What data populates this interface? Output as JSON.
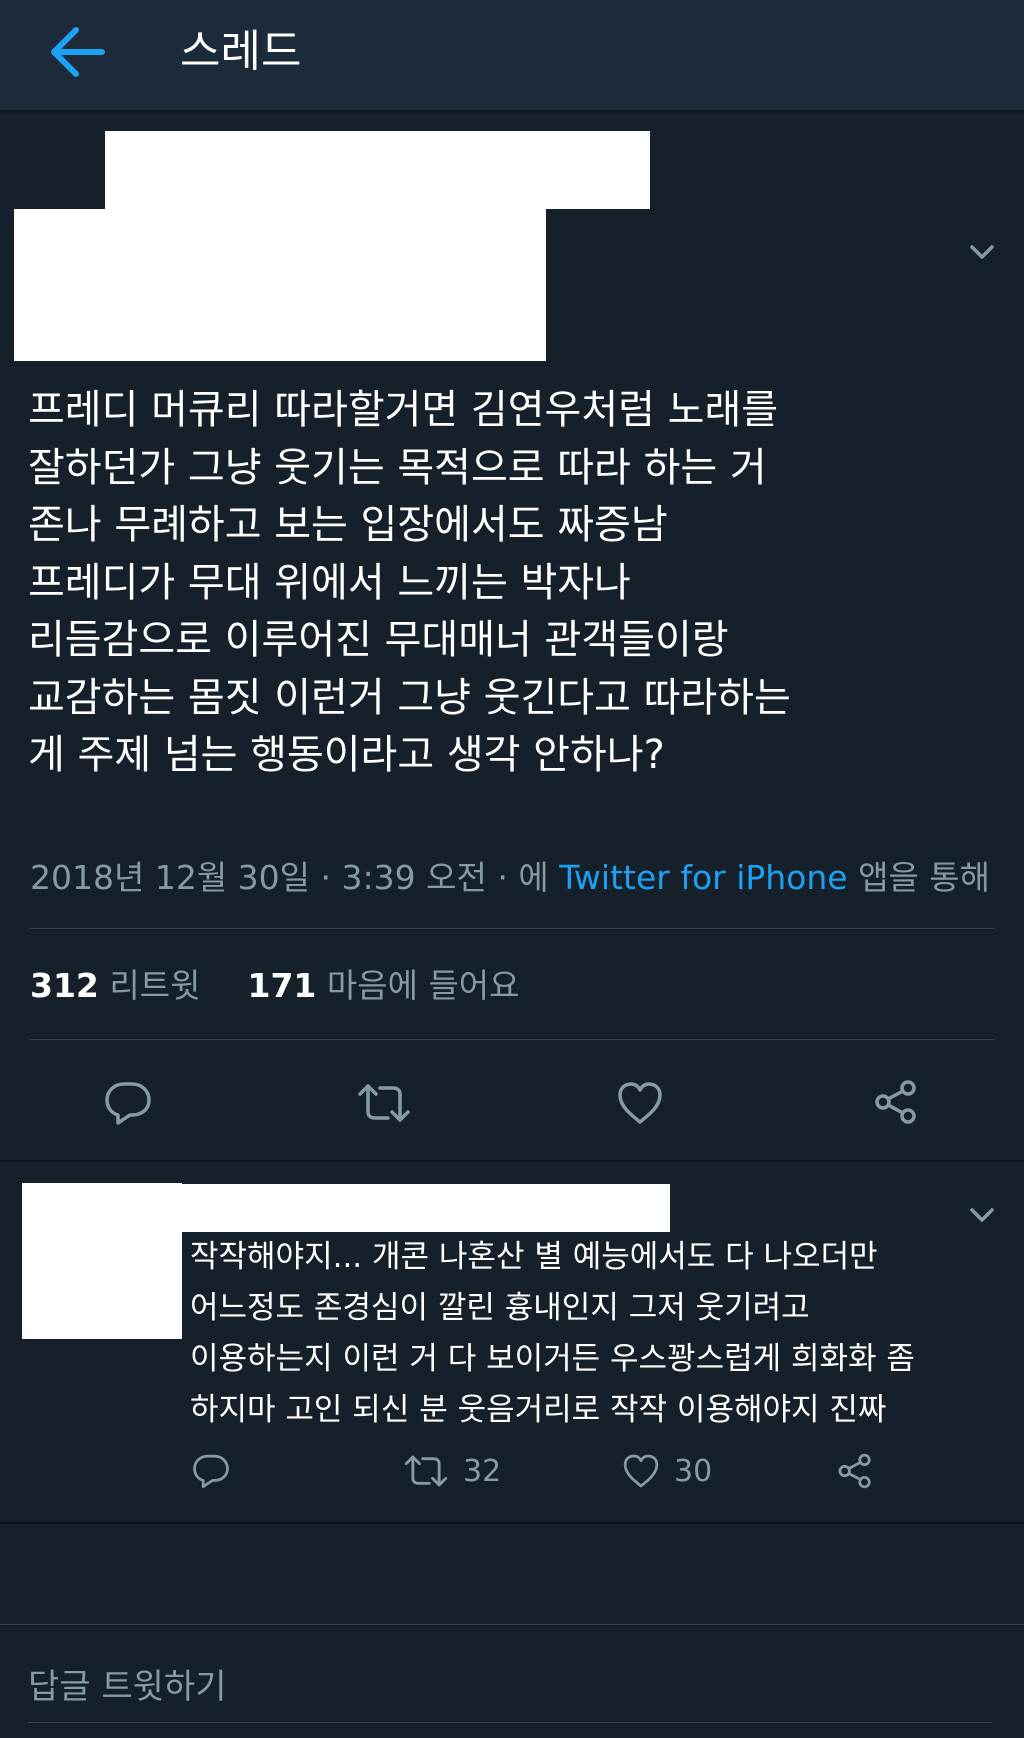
{
  "header": {
    "title": "스레드"
  },
  "tweet": {
    "text_lines": [
      "프레디 머큐리 따라할거면 김연우처럼 노래를",
      "잘하던가 그냥 웃기는 목적으로 따라 하는 거",
      "존나 무례하고 보는 입장에서도 짜증남",
      "프레디가 무대 위에서 느끼는 박자나",
      "리듬감으로 이루어진 무대매너 관객들이랑",
      "교감하는 몸짓 이런거 그냥 웃긴다고 따라하는",
      "게 주제 넘는 행동이라고 생각 안하나?"
    ],
    "meta": {
      "date": "2018년 12월 30일",
      "sep1": "·",
      "time": "3:39 오전",
      "sep2": "·",
      "via": "에",
      "source": "Twitter for iPhone",
      "suffix": "앱을 통해"
    },
    "stats": {
      "retweets": "312",
      "retweets_label": "리트윗",
      "likes": "171",
      "likes_label": "마음에 들어요"
    }
  },
  "reply": {
    "text_lines": [
      "작작해야지... 개콘 나혼산 별 예능에서도 다 나오더만",
      "어느정도 존경심이 깔린 흉내인지 그저 웃기려고",
      "이용하는지 이런 거 다 보이거든 우스꽝스럽게 희화화 좀",
      "하지마 고인 되신 분 웃음거리로 작작 이용해야지 진짜"
    ],
    "retweet_count": "32",
    "like_count": "30"
  },
  "compose": {
    "placeholder": "답글 트윗하기"
  },
  "colors": {
    "background": "#15202b",
    "header": "#1c2a3a",
    "accent": "#1da1f2",
    "muted": "#8899a6",
    "divider": "#38444d"
  },
  "icons": [
    "back-arrow-icon",
    "chevron-down-icon",
    "reply-icon",
    "retweet-icon",
    "heart-icon",
    "share-icon"
  ]
}
